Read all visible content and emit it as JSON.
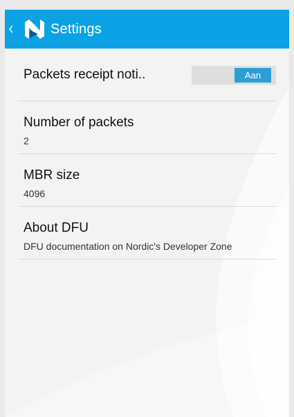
{
  "colors": {
    "actionbar": "#0aa2e4",
    "switch_on": "#2a9fd6",
    "background": "#f3f3f3"
  },
  "actionbar": {
    "title": "Settings",
    "up_icon": "chevron-left-icon",
    "logo_icon": "nordic-n-logo-icon"
  },
  "settings": {
    "packets_receipt": {
      "title": "Packets receipt noti..",
      "switch_state_label": "Aan",
      "enabled": true
    },
    "number_of_packets": {
      "title": "Number of packets",
      "summary": "2"
    },
    "mbr_size": {
      "title": "MBR size",
      "summary": "4096"
    },
    "about_dfu": {
      "title": "About DFU",
      "summary": "DFU documentation on Nordic's Developer Zone"
    }
  }
}
